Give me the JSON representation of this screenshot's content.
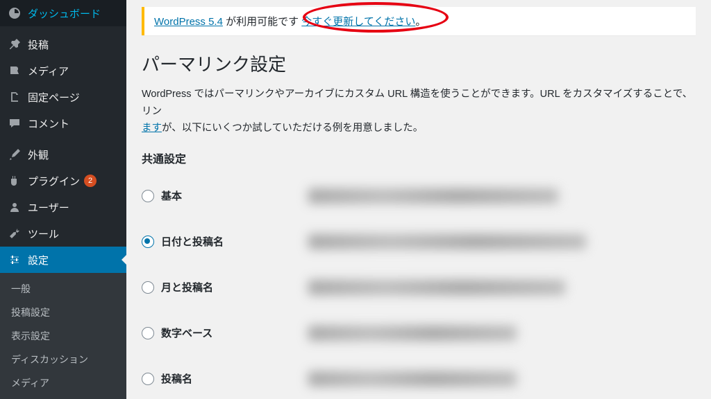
{
  "sidebar": {
    "items": [
      {
        "label": "ダッシュボード",
        "icon": "dashboard"
      },
      {
        "label": "投稿",
        "icon": "pin"
      },
      {
        "label": "メディア",
        "icon": "media"
      },
      {
        "label": "固定ページ",
        "icon": "page"
      },
      {
        "label": "コメント",
        "icon": "comment"
      },
      {
        "label": "外観",
        "icon": "brush"
      },
      {
        "label": "プラグイン",
        "icon": "plugin",
        "badge": "2"
      },
      {
        "label": "ユーザー",
        "icon": "user"
      },
      {
        "label": "ツール",
        "icon": "wrench"
      },
      {
        "label": "設定",
        "icon": "settings",
        "active": true
      }
    ],
    "submenu": [
      "一般",
      "投稿設定",
      "表示設定",
      "ディスカッション",
      "メディア"
    ]
  },
  "notice": {
    "version_link": "WordPress 5.4",
    "middle_text": " が利用可能です ",
    "update_link": "今すぐ更新してください",
    "end": "。"
  },
  "page": {
    "title": "パーマリンク設定",
    "desc_part1": "WordPress ではパーマリンクやアーカイブにカスタム URL 構造を使うことができます。URL をカスタマイズすることで、リン",
    "desc_link": "ます",
    "desc_part2": "が、以下にいくつか試していただける例を用意しました。",
    "section_heading": "共通設定"
  },
  "options": [
    {
      "label": "基本",
      "checked": false
    },
    {
      "label": "日付と投稿名",
      "checked": true
    },
    {
      "label": "月と投稿名",
      "checked": false
    },
    {
      "label": "数字ベース",
      "checked": false
    },
    {
      "label": "投稿名",
      "checked": false
    }
  ]
}
